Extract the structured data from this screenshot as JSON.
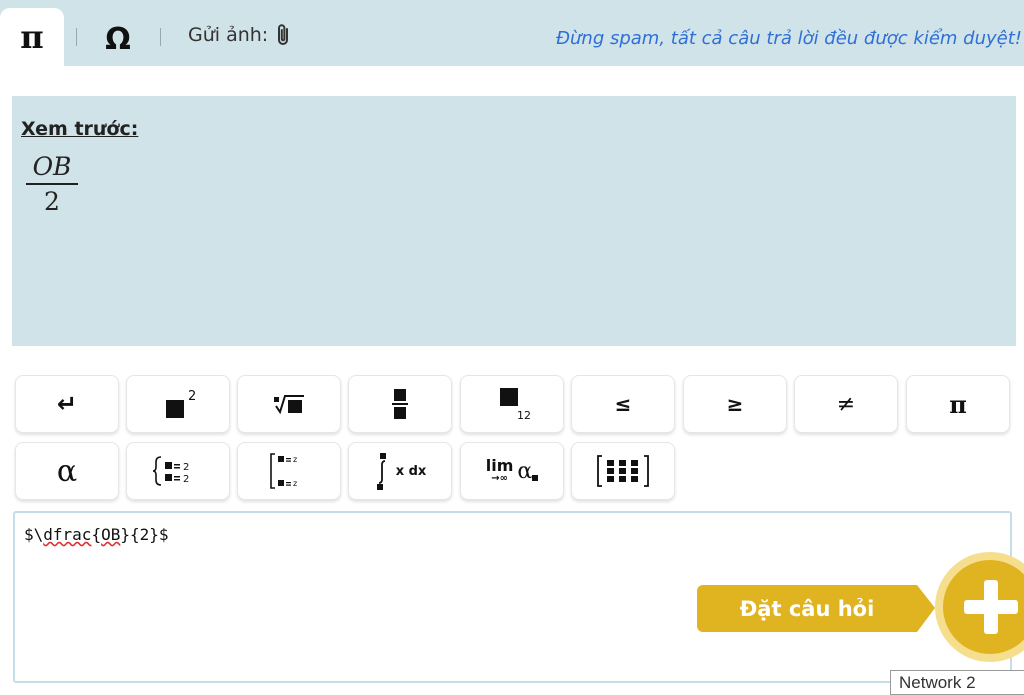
{
  "tabs": {
    "pi": "π",
    "omega": "Ω",
    "upload_label": "Gửi ảnh:"
  },
  "notice": "Đừng spam, tất cả câu trả lời đều được kiểm duyệt!",
  "preview": {
    "label": "Xem trước:",
    "numerator": "OB",
    "denominator": "2"
  },
  "toolbar": {
    "row1": {
      "enter": "↵",
      "square_exp": "2",
      "le": "≤",
      "ge": "≥",
      "ne": "≠",
      "pi": "π"
    },
    "row2": {
      "alpha": "α",
      "integral_text": "x dx",
      "lim_text": "lim",
      "lim_sub": "→∞",
      "lim_alpha": "α"
    },
    "subscript_label": "12"
  },
  "editor": {
    "prefix": "$\\",
    "cmd": "dfrac",
    "arg1_open": "{",
    "arg1": "OB",
    "rest": "}{2}$"
  },
  "ask_button": "Đặt câu hỏi",
  "tooltip": "Network 2",
  "colors": {
    "panel_bg": "#d0e3e8",
    "accent": "#e0b320",
    "notice": "#2f6fd6"
  }
}
